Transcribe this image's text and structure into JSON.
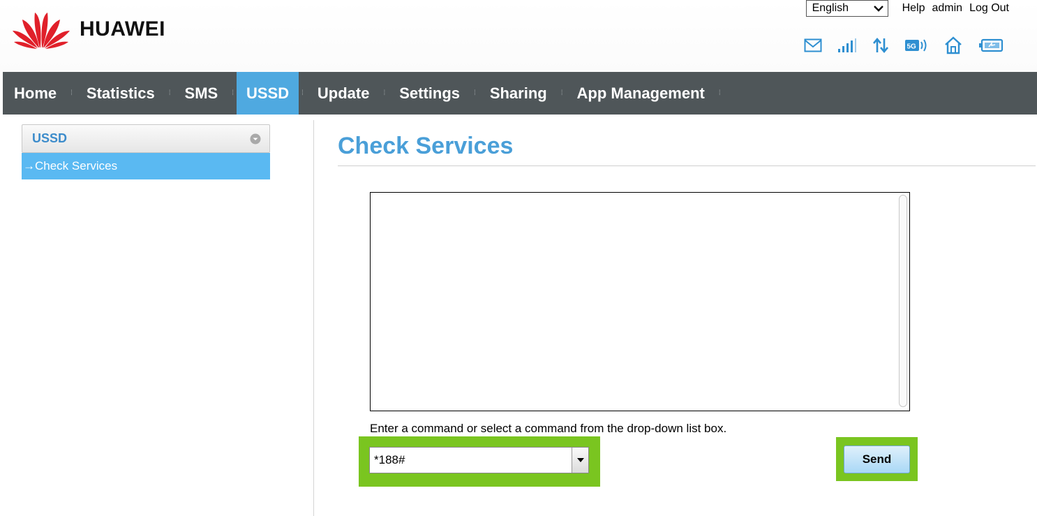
{
  "header": {
    "brand": "HUAWEI",
    "language": "English",
    "links": {
      "help": "Help",
      "user": "admin",
      "logout": "Log Out"
    },
    "status_icons": [
      "mail-icon",
      "signal-icon",
      "data-transfer-icon",
      "5g-icon",
      "home-icon",
      "battery-icon"
    ]
  },
  "nav": {
    "items": [
      {
        "label": "Home"
      },
      {
        "label": "Statistics"
      },
      {
        "label": "SMS"
      },
      {
        "label": "USSD",
        "active": true
      },
      {
        "label": "Update"
      },
      {
        "label": "Settings"
      },
      {
        "label": "Sharing"
      },
      {
        "label": "App Management"
      }
    ]
  },
  "sidebar": {
    "heading": "USSD",
    "items": [
      {
        "label": "Check Services",
        "arrow": "→"
      }
    ]
  },
  "main": {
    "title": "Check Services",
    "response_text": "",
    "hint": "Enter a command or select a command from the drop-down list box.",
    "command_value": "*188#",
    "send_label": "Send"
  },
  "colors": {
    "nav_bg": "#4f5659",
    "accent": "#4fa9e0",
    "sidebar_active": "#5ab9f2",
    "title": "#4a9fd8",
    "highlight": "#7ac520",
    "logo_red": "#e0202a"
  }
}
